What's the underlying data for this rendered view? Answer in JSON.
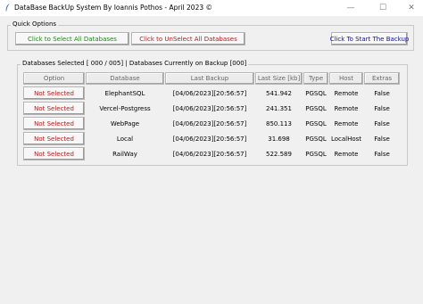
{
  "window": {
    "title": "DataBase BackUp System By Ioannis Pothos - April 2023 ©",
    "minimize": "—",
    "maximize": "☐",
    "close": "✕"
  },
  "quick_options": {
    "label": "Quick Options",
    "select_all": "Click to Select All Databases",
    "unselect_all": "Click to UnSelect All Databases",
    "start_backup": "Click To Start The Backup"
  },
  "databases": {
    "label": "Databases Selected [ 000 / 005] | Databases Currently on Backup [000]",
    "columns": [
      "Option",
      "Database",
      "Last Backup",
      "Last Size [kb]",
      "Type",
      "Host",
      "Extras"
    ],
    "rows": [
      {
        "option": "Not Selected",
        "database": "ElephantSQL",
        "last_backup": "[04/06/2023][20:56:57]",
        "size": "541.942",
        "type": "PGSQL",
        "host": "Remote",
        "extras": "False"
      },
      {
        "option": "Not Selected",
        "database": "Vercel-Postgress",
        "last_backup": "[04/06/2023][20:56:57]",
        "size": "241.351",
        "type": "PGSQL",
        "host": "Remote",
        "extras": "False"
      },
      {
        "option": "Not Selected",
        "database": "WebPage",
        "last_backup": "[04/06/2023][20:56:57]",
        "size": "850.113",
        "type": "PGSQL",
        "host": "Remote",
        "extras": "False"
      },
      {
        "option": "Not Selected",
        "database": "Local",
        "last_backup": "[04/06/2023][20:56:57]",
        "size": "31.698",
        "type": "PGSQL",
        "host": "LocalHost",
        "extras": "False"
      },
      {
        "option": "Not Selected",
        "database": "RailWay",
        "last_backup": "[04/06/2023][20:56:57]",
        "size": "522.589",
        "type": "PGSQL",
        "host": "Remote",
        "extras": "False"
      }
    ]
  },
  "colors": {
    "select_text": "#1a8a1a",
    "unselect_text": "#c01818",
    "start_text": "#1010a8",
    "not_selected_text": "#c01818"
  },
  "icons": {
    "app": "feather-icon"
  }
}
